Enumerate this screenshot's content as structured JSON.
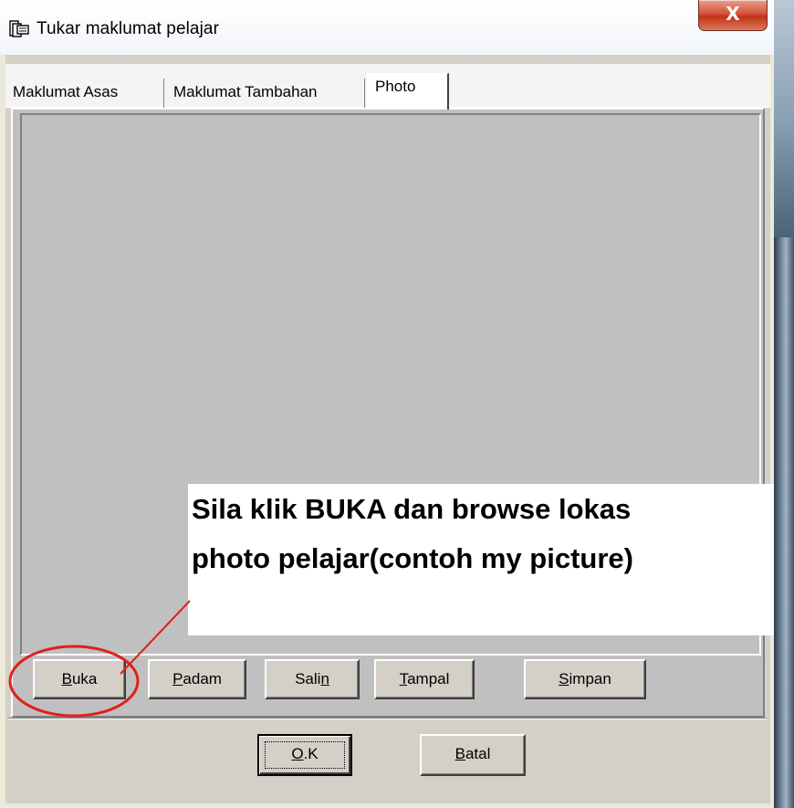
{
  "window": {
    "title": "Tukar maklumat pelajar",
    "close_label": "X",
    "icon": "app-icon"
  },
  "tabs": [
    {
      "label": "Maklumat Asas",
      "active": false
    },
    {
      "label": "Maklumat Tambahan",
      "active": false
    },
    {
      "label": "Photo",
      "active": true
    }
  ],
  "photo_buttons": {
    "buka": {
      "mnemonic": "B",
      "rest": "uka"
    },
    "padam": {
      "mnemonic": "P",
      "rest": "adam"
    },
    "salin": {
      "pre": "Sali",
      "mnemonic": "n"
    },
    "tampal": {
      "mnemonic": "T",
      "rest": "ampal"
    },
    "simpan": {
      "mnemonic": "S",
      "rest": "impan"
    }
  },
  "dialog_buttons": {
    "ok": {
      "mnemonic": "O",
      "rest": ".K"
    },
    "batal": {
      "mnemonic": "B",
      "rest": "atal"
    }
  },
  "annotation": {
    "line1": "Sila klik BUKA dan browse lokas",
    "line2": "photo pelajar(contoh my picture)",
    "highlight_color": "#e0201b",
    "callout_target": "buka-button"
  },
  "colors": {
    "dialog_face": "#d4d0c8",
    "photo_area": "#c0c0c0",
    "close_button": "#c13316"
  }
}
